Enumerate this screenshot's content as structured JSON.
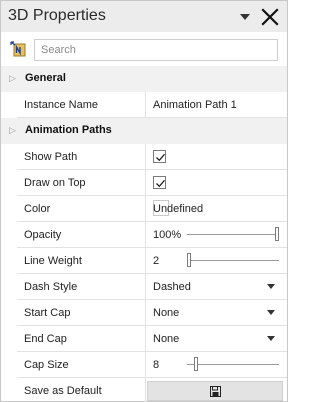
{
  "panel": {
    "title": "3D Properties"
  },
  "search": {
    "placeholder": "Search"
  },
  "categories": {
    "general": "General",
    "animation_paths": "Animation Paths"
  },
  "general": {
    "instance_name": {
      "label": "Instance Name",
      "value": "Animation Path 1"
    }
  },
  "animation_paths": {
    "show_path": {
      "label": "Show Path",
      "checked": true
    },
    "draw_on_top": {
      "label": "Draw on Top",
      "checked": true
    },
    "color": {
      "label": "Color",
      "value": "Undefined",
      "swatch": "#ffffff"
    },
    "opacity": {
      "label": "Opacity",
      "value": "100%",
      "fraction": 1.0
    },
    "line_weight": {
      "label": "Line Weight",
      "value": "2",
      "fraction": 0.0
    },
    "dash_style": {
      "label": "Dash Style",
      "value": "Dashed"
    },
    "start_cap": {
      "label": "Start Cap",
      "value": "None"
    },
    "end_cap": {
      "label": "End Cap",
      "value": "None"
    },
    "cap_size": {
      "label": "Cap Size",
      "value": "8",
      "fraction": 0.08
    },
    "save_as_default": {
      "label": "Save as Default",
      "icon": "save-icon"
    }
  },
  "colors": {
    "title_bar": "#ececec",
    "category_bar": "#f1f1f1",
    "button": "#e3e3e3"
  }
}
